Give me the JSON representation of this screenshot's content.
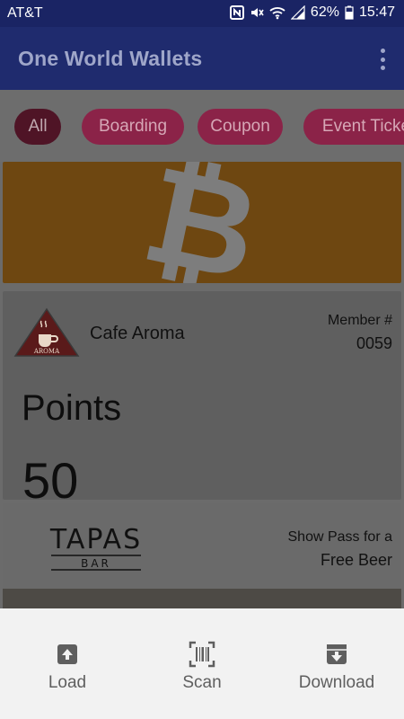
{
  "status_bar": {
    "carrier": "AT&T",
    "battery": "62%",
    "time": "15:47",
    "icons": [
      "nfc-icon",
      "mute-icon",
      "wifi-icon",
      "signal-icon",
      "battery-icon"
    ]
  },
  "app_bar": {
    "title": "One World Wallets",
    "menu_icon": "more-vert-icon"
  },
  "filters": [
    {
      "label": "All",
      "active": true
    },
    {
      "label": "Boarding",
      "active": false
    },
    {
      "label": "Coupon",
      "active": false
    },
    {
      "label": "Event Ticke",
      "active": false
    }
  ],
  "cards": {
    "bitcoin": {
      "icon": "bitcoin-icon",
      "color": "#f7931a"
    },
    "cafe": {
      "name": "Cafe Aroma",
      "logo_text": "AROMA",
      "member_label": "Member #",
      "member_number": "0059",
      "points_label": "Points",
      "points_value": "50"
    },
    "tapas": {
      "logo_line1": "TAPAS",
      "logo_line2": "BAR",
      "promo_line1": "Show Pass for a",
      "promo_line2": "Free Beer"
    }
  },
  "bottom_actions": [
    {
      "label": "Load",
      "icon": "upload-icon"
    },
    {
      "label": "Scan",
      "icon": "barcode-scan-icon"
    },
    {
      "label": "Download",
      "icon": "download-icon"
    }
  ],
  "colors": {
    "app_bar": "#3f51b5",
    "chip": "#e91e63",
    "overlay": "rgba(0,0,0,0.55)"
  }
}
